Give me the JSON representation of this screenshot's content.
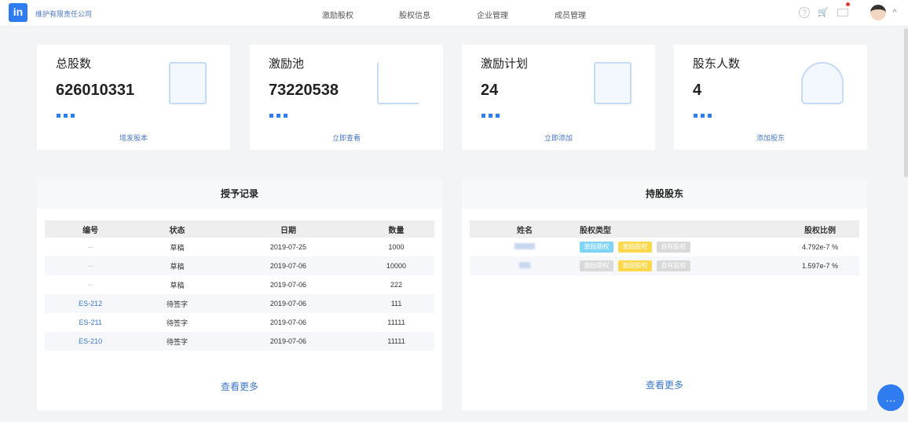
{
  "header": {
    "logo": "in",
    "company": "维护有限责任公司",
    "nav": [
      "激励股权",
      "股权信息",
      "企业管理",
      "成员管理"
    ]
  },
  "cards": [
    {
      "title": "总股数",
      "value": "626010331",
      "link": "增发股本"
    },
    {
      "title": "激励池",
      "value": "73220538",
      "link": "立即查看"
    },
    {
      "title": "激励计划",
      "value": "24",
      "link": "立即添加"
    },
    {
      "title": "股东人数",
      "value": "4",
      "link": "添加股东"
    }
  ],
  "grants": {
    "title": "授予记录",
    "columns": [
      "编号",
      "状态",
      "日期",
      "数量"
    ],
    "rows": [
      [
        "--",
        "草稿",
        "2019-07-25",
        "1000"
      ],
      [
        "--",
        "草稿",
        "2019-07-06",
        "10000"
      ],
      [
        "--",
        "草稿",
        "2019-07-06",
        "222"
      ],
      [
        "ES-212",
        "待签字",
        "2019-07-06",
        "111"
      ],
      [
        "ES-211",
        "待签字",
        "2019-07-06",
        "11111"
      ],
      [
        "ES-210",
        "待签字",
        "2019-07-06",
        "11111"
      ]
    ],
    "more": "查看更多"
  },
  "holders": {
    "title": "持股股东",
    "columns": [
      "姓名",
      "股权类型",
      "股权比例"
    ],
    "tags": [
      "激励期权",
      "激励股权",
      "自有股权"
    ],
    "rows": [
      {
        "ratio": "4.792e-7 %",
        "active": [
          true,
          true,
          false
        ]
      },
      {
        "ratio": "1.597e-7 %",
        "active": [
          false,
          true,
          false
        ]
      }
    ],
    "more": "查看更多"
  },
  "colors": {
    "accent": "#2f7bf0",
    "option": "#7fd3f7",
    "stock": "#fcd84a",
    "inactive": "#d9d9d9"
  }
}
